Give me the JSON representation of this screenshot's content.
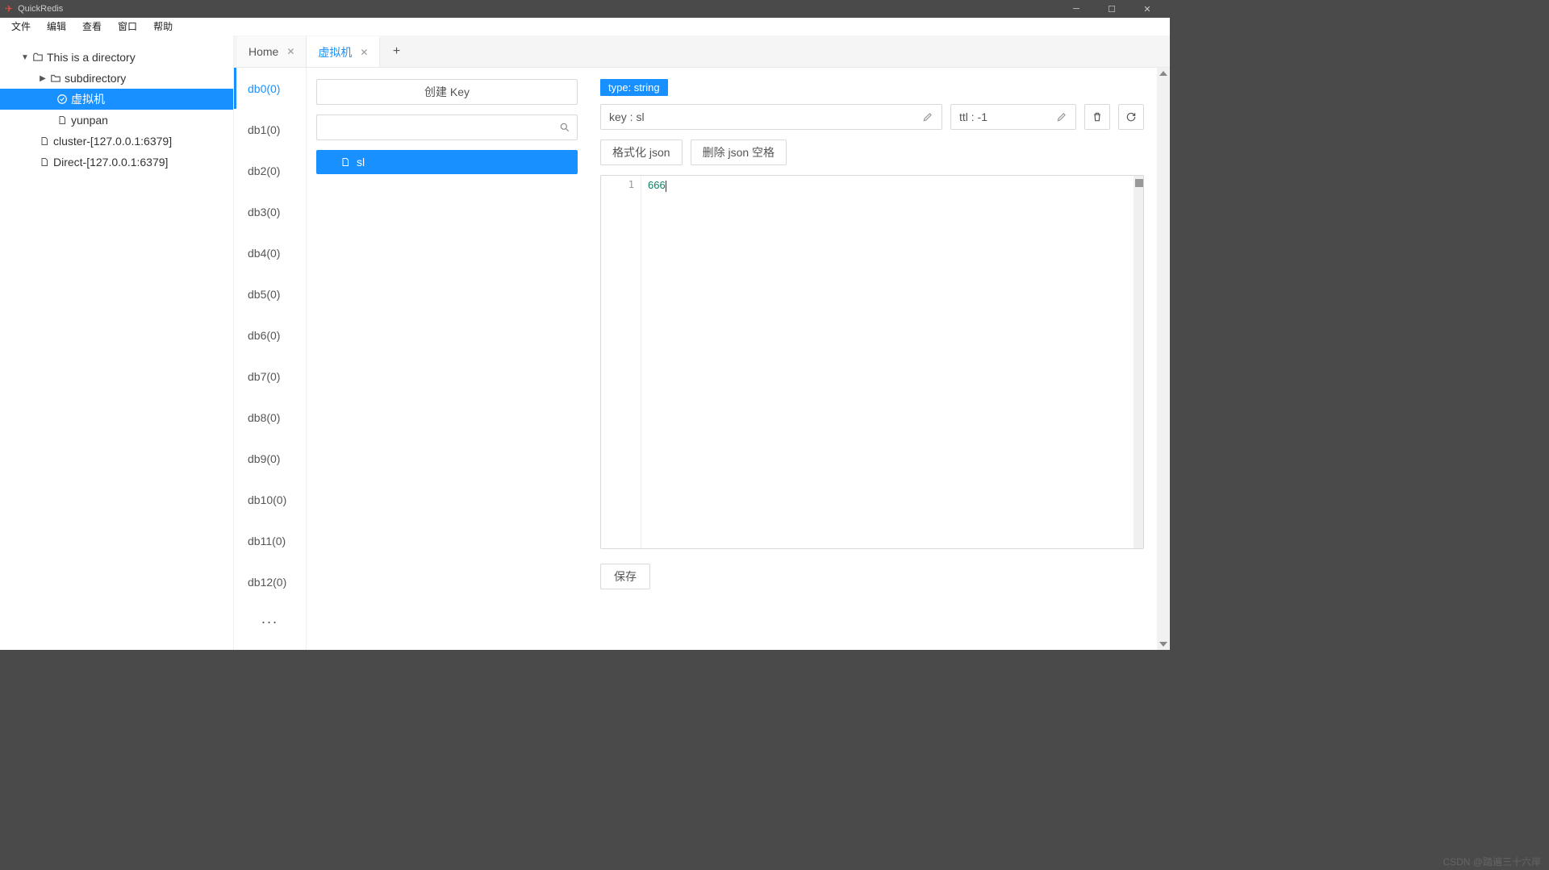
{
  "titlebar": {
    "app_name": "QuickRedis"
  },
  "menubar": {
    "items": [
      "文件",
      "编辑",
      "查看",
      "窗口",
      "帮助"
    ]
  },
  "sidebar": {
    "nodes": [
      {
        "label": "This is a directory"
      },
      {
        "label": "subdirectory"
      },
      {
        "label": "虚拟机"
      },
      {
        "label": "yunpan"
      },
      {
        "label": "cluster-[127.0.0.1:6379]"
      },
      {
        "label": "Direct-[127.0.0.1:6379]"
      }
    ]
  },
  "tabs": {
    "items": [
      {
        "label": "Home"
      },
      {
        "label": "虚拟机"
      }
    ]
  },
  "dblist": {
    "items": [
      "db0(0)",
      "db1(0)",
      "db2(0)",
      "db3(0)",
      "db4(0)",
      "db5(0)",
      "db6(0)",
      "db7(0)",
      "db8(0)",
      "db9(0)",
      "db10(0)",
      "db11(0)",
      "db12(0)"
    ],
    "more": "..."
  },
  "keypanel": {
    "create_key_label": "创建 Key",
    "search_placeholder": "",
    "keys": [
      {
        "name": "sl"
      }
    ]
  },
  "detail": {
    "type_badge": "type: string",
    "key_label": "key : sl",
    "ttl_label": "ttl : -1",
    "format_json": "格式化 json",
    "delete_json": "删除 json 空格",
    "line_no": "1",
    "value": "666",
    "save_label": "保存"
  },
  "watermark": "CSDN @踏遍三十六岸"
}
